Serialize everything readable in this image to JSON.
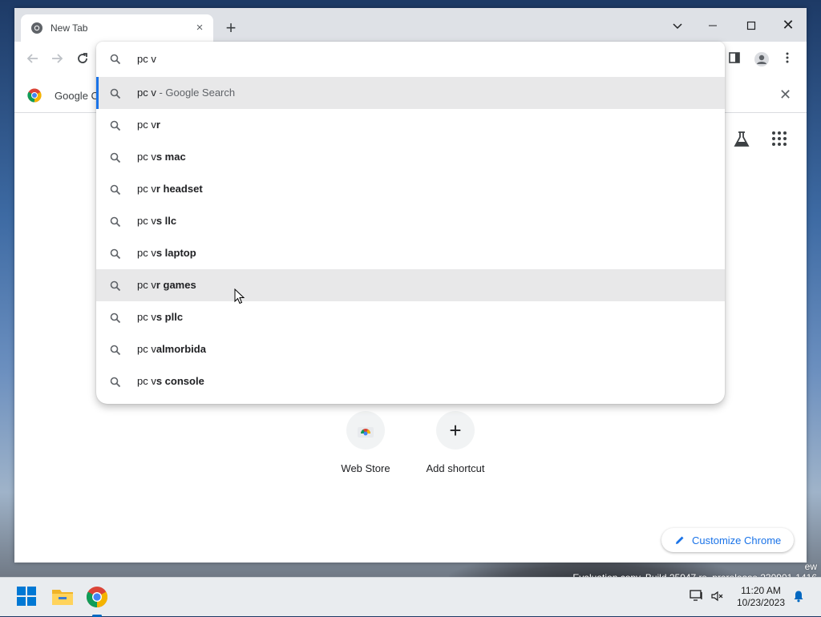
{
  "window": {
    "tab_title": "New Tab",
    "tab_close": "×",
    "new_tab": "+",
    "tab_search_icon": "chevron-down",
    "close_symbol": "✕"
  },
  "bookmarks": {
    "google_label": "Google C",
    "close_symbol": "✕"
  },
  "omnibox": {
    "input_value": "pc v",
    "suggestions": [
      {
        "typed": "pc v",
        "completion": "",
        "hint": " - Google Search",
        "state": "selected"
      },
      {
        "typed": "pc v",
        "completion": "r",
        "hint": "",
        "state": ""
      },
      {
        "typed": "pc v",
        "completion": "s mac",
        "hint": "",
        "state": ""
      },
      {
        "typed": "pc v",
        "completion": "r headset",
        "hint": "",
        "state": ""
      },
      {
        "typed": "pc v",
        "completion": "s llc",
        "hint": "",
        "state": ""
      },
      {
        "typed": "pc v",
        "completion": "s laptop",
        "hint": "",
        "state": ""
      },
      {
        "typed": "pc v",
        "completion": "r games",
        "hint": "",
        "state": "hovered"
      },
      {
        "typed": "pc v",
        "completion": "s pllc",
        "hint": "",
        "state": ""
      },
      {
        "typed": "pc v",
        "completion": "almorbida",
        "hint": "",
        "state": ""
      },
      {
        "typed": "pc v",
        "completion": "s console",
        "hint": "",
        "state": ""
      }
    ]
  },
  "shortcuts": {
    "web_store": "Web Store",
    "add_shortcut": "Add shortcut",
    "add_symbol": "+"
  },
  "customize": {
    "label": "Customize Chrome"
  },
  "desktop": {
    "watermark_line1": "ew",
    "watermark_line2": "Evaluation copy. Build 25947.rs_prerelease.230901-1416"
  },
  "taskbar": {
    "time": "11:20 AM",
    "date": "10/23/2023"
  },
  "colors": {
    "accent": "#1a73e8",
    "taskbar": "#e9ecef",
    "titlebar": "#dee1e6"
  }
}
